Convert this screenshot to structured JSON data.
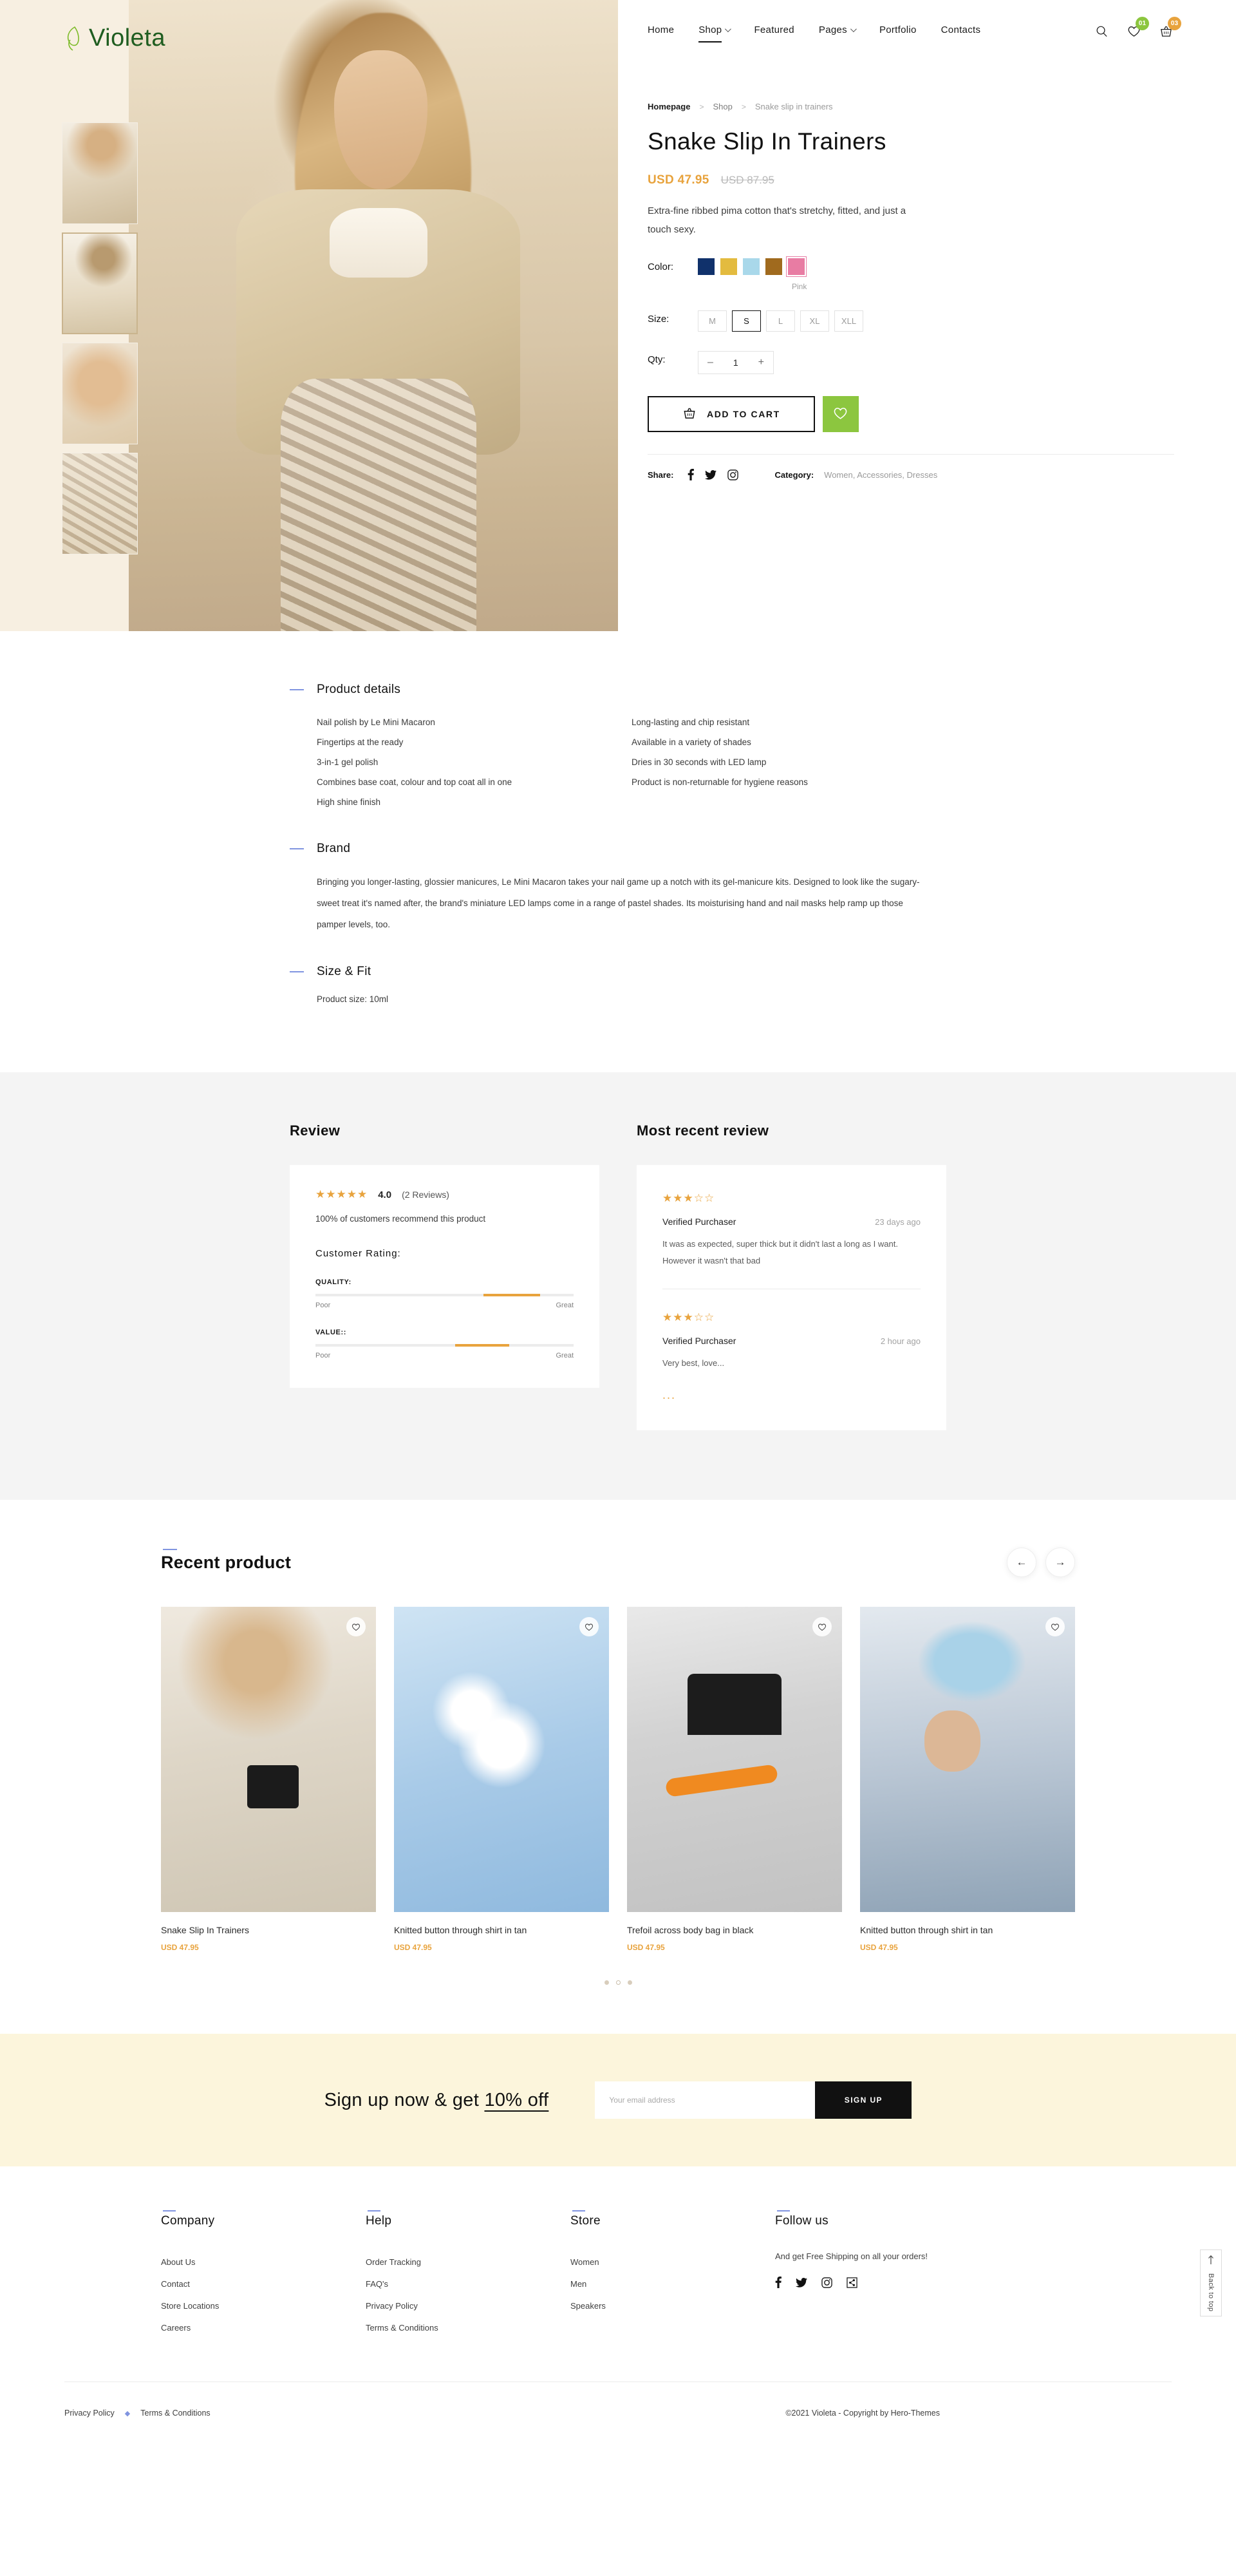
{
  "brand": {
    "name": "Violeta",
    "leaf_icon": "leaf-icon"
  },
  "nav": {
    "items": [
      {
        "label": "Home",
        "has_caret": false,
        "active": false
      },
      {
        "label": "Shop",
        "has_caret": true,
        "active": true
      },
      {
        "label": "Featured",
        "has_caret": false,
        "active": false
      },
      {
        "label": "Pages",
        "has_caret": true,
        "active": false
      },
      {
        "label": "Portfolio",
        "has_caret": false,
        "active": false
      },
      {
        "label": "Contacts",
        "has_caret": false,
        "active": false
      }
    ],
    "search_icon": "search-icon",
    "wishlist_icon": "heart-icon",
    "wishlist_count": "01",
    "wishlist_badge_color": "#8cc63f",
    "cart_icon": "basket-icon",
    "cart_count": "03",
    "cart_badge_color": "#e8a33d"
  },
  "gallery": {
    "thumbs": [
      {
        "alt": "model front view",
        "active": false
      },
      {
        "alt": "model back view",
        "active": true
      },
      {
        "alt": "model close up",
        "active": false
      },
      {
        "alt": "model seated",
        "active": false
      }
    ]
  },
  "breadcrumb": {
    "home": "Homepage",
    "shop": "Shop",
    "current": "Snake slip in trainers",
    "separator": ">"
  },
  "product": {
    "title": "Snake Slip In Trainers",
    "price": "USD 47.95",
    "price_old": "USD 87.95",
    "price_color": "#e8a33d",
    "description": "Extra-fine ribbed pima cotton that's stretchy, fitted, and just a touch sexy.",
    "color_label": "Color:",
    "colors": [
      {
        "name": "Navy",
        "hex": "#10316b",
        "selected": false
      },
      {
        "name": "Gold",
        "hex": "#e3bb3f",
        "selected": false
      },
      {
        "name": "Light Blue",
        "hex": "#a9d8ea",
        "selected": false
      },
      {
        "name": "Brown",
        "hex": "#a06a1e",
        "selected": false
      },
      {
        "name": "Pink",
        "hex": "#e87ca3",
        "selected": true
      }
    ],
    "selected_color_name": "Pink",
    "size_label": "Size:",
    "sizes": [
      {
        "label": "M",
        "selected": false
      },
      {
        "label": "S",
        "selected": true
      },
      {
        "label": "L",
        "selected": false
      },
      {
        "label": "XL",
        "selected": false
      },
      {
        "label": "XLL",
        "selected": false
      }
    ],
    "qty_label": "Qty:",
    "qty_minus": "–",
    "qty_value": "1",
    "qty_plus": "+",
    "add_to_cart": "ADD TO CART",
    "cart_icon": "basket-icon",
    "wishlist_icon": "heart-icon",
    "wishlist_bg": "#8cc63f",
    "share_label": "Share:",
    "share_icons": [
      "facebook-icon",
      "twitter-icon",
      "instagram-icon"
    ],
    "category_label": "Category:",
    "categories": "Women, Accessories, Dresses"
  },
  "details": {
    "accordion_color": "#8094e0",
    "sections": [
      {
        "title": "Product details",
        "col_left": [
          "Nail polish by Le Mini Macaron",
          "Fingertips at the ready",
          "3-in-1 gel polish",
          "Combines base coat, colour and top coat all in one",
          "High shine finish"
        ],
        "col_right": [
          "Long-lasting and chip resistant",
          "Available in a variety of shades",
          "Dries in 30 seconds with LED lamp",
          "Product is non-returnable for hygiene reasons"
        ]
      },
      {
        "title": "Brand",
        "paragraph": "Bringing you longer-lasting, glossier manicures, Le Mini Macaron takes your nail game up a notch with its gel-manicure kits. Designed to look like the sugary-sweet treat it's named after, the brand's miniature LED lamps come in a range of pastel shades. Its moisturising hand and nail masks help ramp up those pamper levels, too."
      },
      {
        "title": "Size & Fit",
        "paragraph": "Product size: 10ml"
      }
    ]
  },
  "review": {
    "heading": "Review",
    "stars_filled": 5,
    "rating": "4.0",
    "count_text": "(2 Reviews)",
    "recommend": "100% of customers recommend this product",
    "customer_rating_label": "Customer Rating:",
    "bars": [
      {
        "label": "QUALITY:",
        "start_pct": 65,
        "width_pct": 22,
        "low": "Poor",
        "high": "Great"
      },
      {
        "label": "VALUE::",
        "start_pct": 54,
        "width_pct": 21,
        "low": "Poor",
        "high": "Great"
      }
    ],
    "bar_color": "#e8a33d"
  },
  "recent_review": {
    "heading": "Most recent review",
    "items": [
      {
        "stars_filled": 3,
        "stars_total": 5,
        "name": "Verified Purchaser",
        "time": "23 days ago",
        "text": "It was as expected, super thick but it didn't last a long as I want. However it wasn't that bad"
      },
      {
        "stars_filled": 3,
        "stars_total": 5,
        "name": "Verified Purchaser",
        "time": "2 hour ago",
        "text": "Very best, love..."
      }
    ],
    "more_indicator": "..."
  },
  "recent_products": {
    "heading": "Recent product",
    "prev_icon": "arrow-left-icon",
    "next_icon": "arrow-right-icon",
    "wishlist_icon": "heart-icon",
    "items": [
      {
        "name": "Snake Slip In Trainers",
        "price": "USD 47.95"
      },
      {
        "name": "Knitted button through shirt in tan",
        "price": "USD 47.95"
      },
      {
        "name": "Trefoil across body bag in black",
        "price": "USD 47.95"
      },
      {
        "name": "Knitted button through shirt in tan",
        "price": "USD 47.95"
      }
    ],
    "dots": [
      false,
      true,
      false
    ]
  },
  "newsletter": {
    "heading_plain": "Sign up now & get ",
    "heading_underline": "10% off",
    "placeholder": "Your email address",
    "button": "SIGN UP",
    "bg": "#fcf5dc"
  },
  "footer": {
    "accent": "#8094e0",
    "columns": [
      {
        "title": "Company",
        "links": [
          "About Us",
          "Contact",
          "Store Locations",
          "Careers"
        ]
      },
      {
        "title": "Help",
        "links": [
          "Order Tracking",
          "FAQ's",
          "Privacy Policy",
          "Terms & Conditions"
        ]
      },
      {
        "title": "Store",
        "links": [
          "Women",
          "Men",
          "Speakers"
        ]
      }
    ],
    "follow": {
      "title": "Follow us",
      "note": "And get Free Shipping on all your orders!",
      "icons": [
        "facebook-icon",
        "twitter-icon",
        "instagram-icon",
        "share-icon"
      ]
    },
    "bottom": {
      "privacy": "Privacy Policy",
      "dot": "◆",
      "terms": "Terms & Conditions",
      "copyright": "©2021 Violeta - Copyright by Hero-Themes"
    },
    "back_to_top": {
      "label": "Back to top",
      "icon": "arrow-up-icon"
    }
  }
}
